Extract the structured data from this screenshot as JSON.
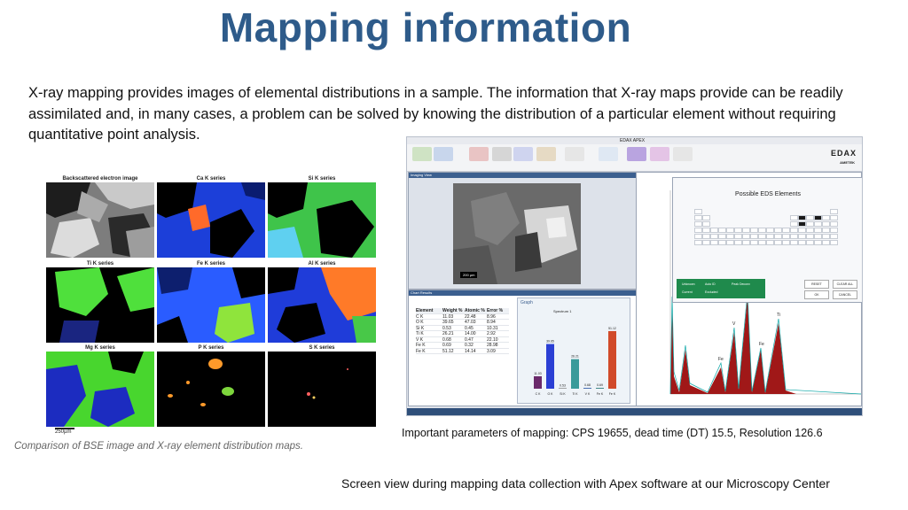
{
  "slide": {
    "title": "Mapping information",
    "intro": "X-ray mapping provides images of elemental distributions in a sample. The information that X-ray maps provide can be readily assimilated and, in many cases, a problem can be solved by knowing the distribution of a particular element without requiring quantitative point analysis.",
    "left_caption": "Comparison of BSE image and X-ray element distribution maps.",
    "params_caption": "Important parameters of mapping: CPS 19655,  dead time (DT) 15.5, Resolution 126.6",
    "footer_caption": "Screen view during mapping data collection with Apex software at our Microscopy Center"
  },
  "figure": {
    "cells": [
      {
        "label": "Backscattered electron image",
        "base": "#8a8a8a",
        "accent": "#dcdcdc"
      },
      {
        "label": "Ca K series",
        "base": "#1a3fd6",
        "accent": "#ff6a2a"
      },
      {
        "label": "Si K series",
        "base": "#3fc03f",
        "accent": "#56c3ff"
      },
      {
        "label": "Ti K series",
        "base": "#45d93a",
        "accent": "#1a1a6a"
      },
      {
        "label": "Fe K series",
        "base": "#2a64ff",
        "accent": "#8ee03a"
      },
      {
        "label": "Al K series",
        "base": "#ff7a28",
        "accent": "#1f3cd9"
      },
      {
        "label": "Mg K series",
        "base": "#48d62e",
        "accent": "#1c2cc0"
      },
      {
        "label": "P K series",
        "base": "#000000",
        "accent": "#ff9a2a"
      },
      {
        "label": "S K series",
        "base": "#000000",
        "accent": "#ff6060"
      }
    ],
    "scale": "250µm"
  },
  "app": {
    "title": "EDAX APEX",
    "brand": "EDAX",
    "brand_sub": "AMETEK",
    "imaging_panel": "Imaging View",
    "scale_bar": "200 µm",
    "results_panel": "Chart Results",
    "table_headers": [
      "Element",
      "Weight %",
      "Atomic %",
      "Error %"
    ],
    "table_rows": [
      [
        "C K",
        "11.03",
        "22.48",
        "8.96"
      ],
      [
        "O K",
        "39.65",
        "47.03",
        "8.94"
      ],
      [
        "Si K",
        "0.53",
        "0.45",
        "10.31"
      ],
      [
        "Ti K",
        "26.21",
        "14.00",
        "2.92"
      ],
      [
        "V K",
        "0.68",
        "0.47",
        "22.10"
      ],
      [
        "Fe K",
        "0.69",
        "0.32",
        "28.98"
      ],
      [
        "Fe K",
        "51.12",
        "14.14",
        "3.09"
      ]
    ],
    "graph_label": "Graph",
    "spectrum_label": "Spectrum 1",
    "bar_labels": [
      "C K",
      "O K",
      "Si K",
      "Ti K",
      "V K",
      "Fe K",
      "Fe K"
    ],
    "bar_values": [
      "11.03",
      "39.65",
      "0.53",
      "26.21",
      "0.68",
      "0.69",
      "51.12"
    ],
    "periodic_title": "Possible EDS Elements",
    "legend": [
      "Unknown",
      "Auto ID",
      "Peak Deconv",
      "Current",
      "Excluded"
    ],
    "buttons": [
      "RESET",
      "CLEAR ALL",
      "OK",
      "CANCEL"
    ],
    "peak_labels": [
      "O",
      "Ti",
      "V",
      "Fe",
      "Fe"
    ]
  }
}
